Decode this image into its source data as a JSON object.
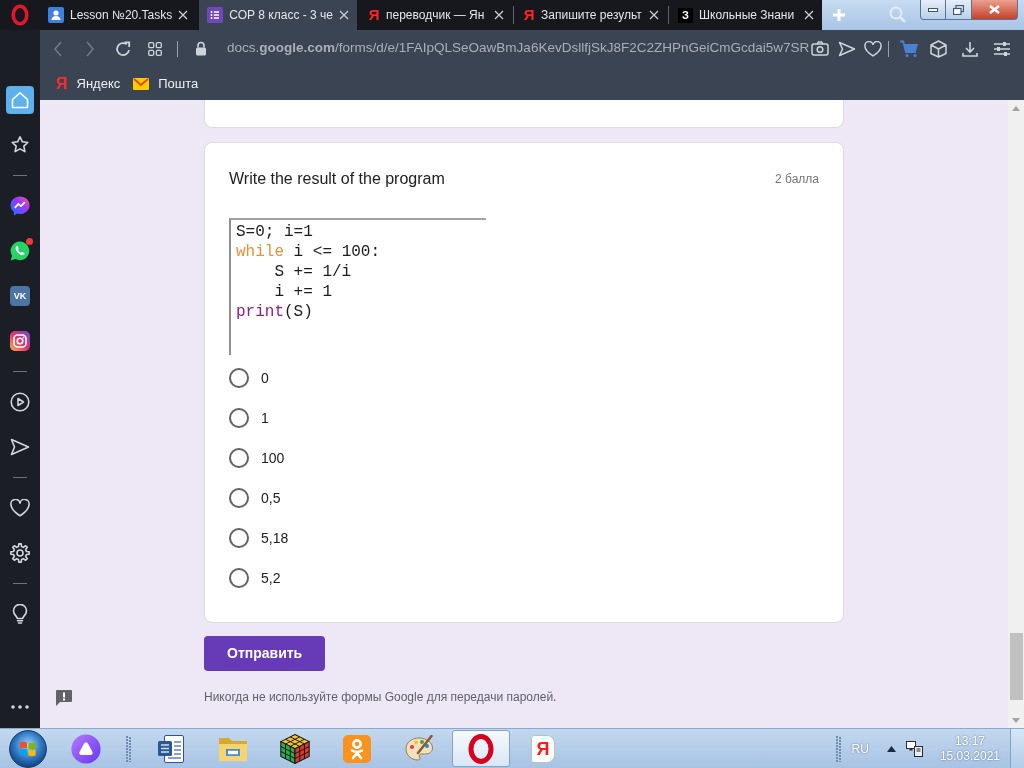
{
  "browser": {
    "tabs": [
      {
        "title": "Lesson №20.Tasks",
        "kind": "person",
        "selected": false
      },
      {
        "title": "СОР 8 класс - 3 че",
        "kind": "list",
        "selected": true
      },
      {
        "title": "переводчик — Ян",
        "kind": "letter",
        "glyph": "Я",
        "selected": false
      },
      {
        "title": "Запишите результ",
        "kind": "letter",
        "glyph": "Я",
        "selected": false
      },
      {
        "title": "Школьные Знани",
        "kind": "tile",
        "glyph": "З",
        "selected": false
      }
    ],
    "address": {
      "url": "docs.**google.com**/forms/d/e/1FAIpQLSeOawBmJa6KevDsllfjSkJ8F2C2ZHPnGeiCmGcdai5w7SR"
    },
    "bookmarks": [
      {
        "label": "Яндекс",
        "kind": "letter",
        "glyph": "Я"
      },
      {
        "label": "Пошта",
        "kind": "mail"
      }
    ]
  },
  "sidebar": {
    "items": [
      {
        "kind": "home",
        "selected": true
      },
      {
        "kind": "star",
        "selected": false
      },
      {
        "kind": "divider"
      },
      {
        "kind": "messenger",
        "selected": false
      },
      {
        "kind": "whatsapp",
        "selected": false,
        "notification": true
      },
      {
        "kind": "vk",
        "glyph": "VK",
        "selected": false
      },
      {
        "kind": "instagram",
        "selected": false
      },
      {
        "kind": "divider"
      },
      {
        "kind": "player",
        "selected": false
      },
      {
        "kind": "send",
        "selected": false
      },
      {
        "kind": "divider"
      },
      {
        "kind": "heart",
        "selected": false
      },
      {
        "kind": "settings",
        "selected": false
      },
      {
        "kind": "divider"
      },
      {
        "kind": "bulb",
        "selected": false
      },
      {
        "kind": "more"
      }
    ]
  },
  "form": {
    "question": {
      "title": "Write the result of the program",
      "points": "2 балла",
      "code": [
        [
          {
            "text": "S=0; i=1",
            "kind": "plain"
          }
        ],
        [
          {
            "text": "while",
            "kind": "keyword"
          },
          {
            "text": " i <= 100:",
            "kind": "plain"
          }
        ],
        [
          {
            "text": "    S += 1/i",
            "kind": "plain"
          }
        ],
        [
          {
            "text": "    i += 1",
            "kind": "plain"
          }
        ],
        [
          {
            "text": "print",
            "kind": "builtin"
          },
          {
            "text": "(S)",
            "kind": "plain"
          }
        ]
      ],
      "options": [
        {
          "label": "0",
          "selected": false
        },
        {
          "label": "1",
          "selected": false
        },
        {
          "label": "100",
          "selected": false
        },
        {
          "label": "0,5",
          "selected": false
        },
        {
          "label": "5,18",
          "selected": false
        },
        {
          "label": "5,2",
          "selected": false
        }
      ]
    },
    "submit": {
      "label": "Отправить"
    },
    "notice": "Никогда не используйте формы Google для передачи паролей."
  },
  "taskbar": {
    "apps": [
      {
        "kind": "assistant",
        "selected": false
      },
      {
        "kind": "grip"
      },
      {
        "kind": "word",
        "selected": false
      },
      {
        "kind": "explorer",
        "selected": false
      },
      {
        "kind": "cube",
        "selected": false
      },
      {
        "kind": "ok",
        "selected": false
      },
      {
        "kind": "paint",
        "selected": false
      },
      {
        "kind": "opera",
        "selected": true
      },
      {
        "kind": "yandex",
        "glyph": "Я",
        "selected": false
      }
    ],
    "language": "RU",
    "time": "13:17",
    "date": "15.03.2021"
  }
}
